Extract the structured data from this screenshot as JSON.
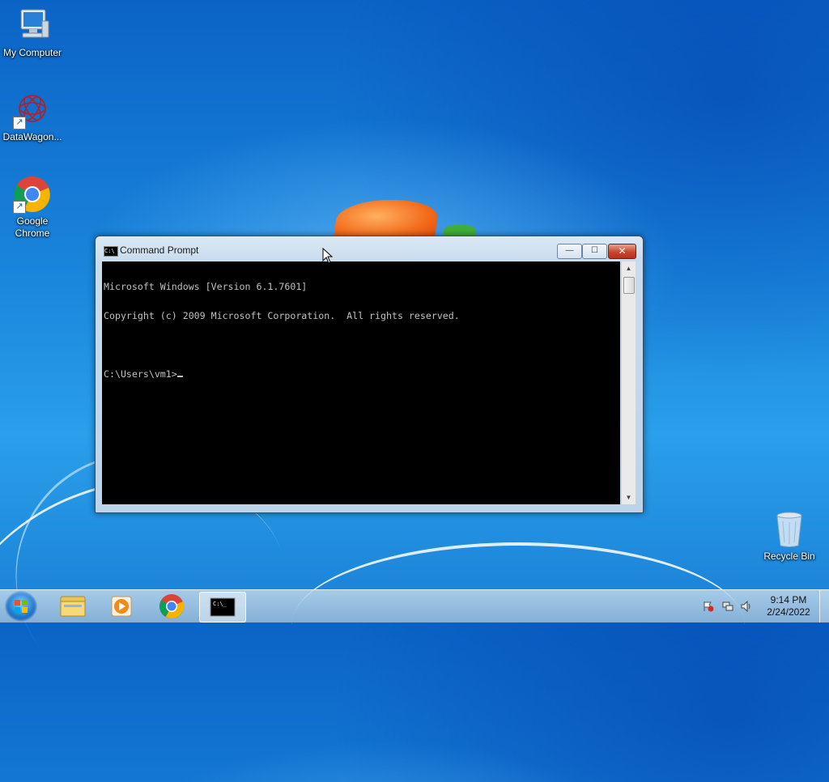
{
  "desktop": {
    "icons": [
      {
        "label": "My Computer",
        "icon": "computer-icon"
      },
      {
        "label": "DataWagon...",
        "icon": "datawagon-icon"
      },
      {
        "label": "Google Chrome",
        "icon": "chrome-icon"
      },
      {
        "label": "Recycle Bin",
        "icon": "recycle-bin-icon"
      }
    ]
  },
  "window": {
    "title": "Command Prompt",
    "title_icon_text": "C:\\",
    "minimize_glyph": "—",
    "maximize_glyph": "☐",
    "close_glyph": "✕",
    "console_lines": [
      "Microsoft Windows [Version 6.1.7601]",
      "Copyright (c) 2009 Microsoft Corporation.  All rights reserved.",
      "",
      "C:\\Users\\vm1>"
    ]
  },
  "taskbar": {
    "items": [
      {
        "name": "file-explorer",
        "icon": "folder-icon",
        "active": false
      },
      {
        "name": "media-player",
        "icon": "media-player-icon",
        "active": false
      },
      {
        "name": "chrome",
        "icon": "chrome-icon",
        "active": false
      },
      {
        "name": "command-prompt",
        "icon": "cmd-icon",
        "active": true
      }
    ],
    "tray_icons": [
      "action-center-flag-icon",
      "network-icon",
      "volume-icon"
    ],
    "clock": {
      "time": "9:14 PM",
      "date": "2/24/2022"
    }
  },
  "colors": {
    "console_bg": "#000000",
    "console_fg": "#c0c0c0",
    "close_button": "#c9452c",
    "desktop_blue": "#1a86dc"
  }
}
